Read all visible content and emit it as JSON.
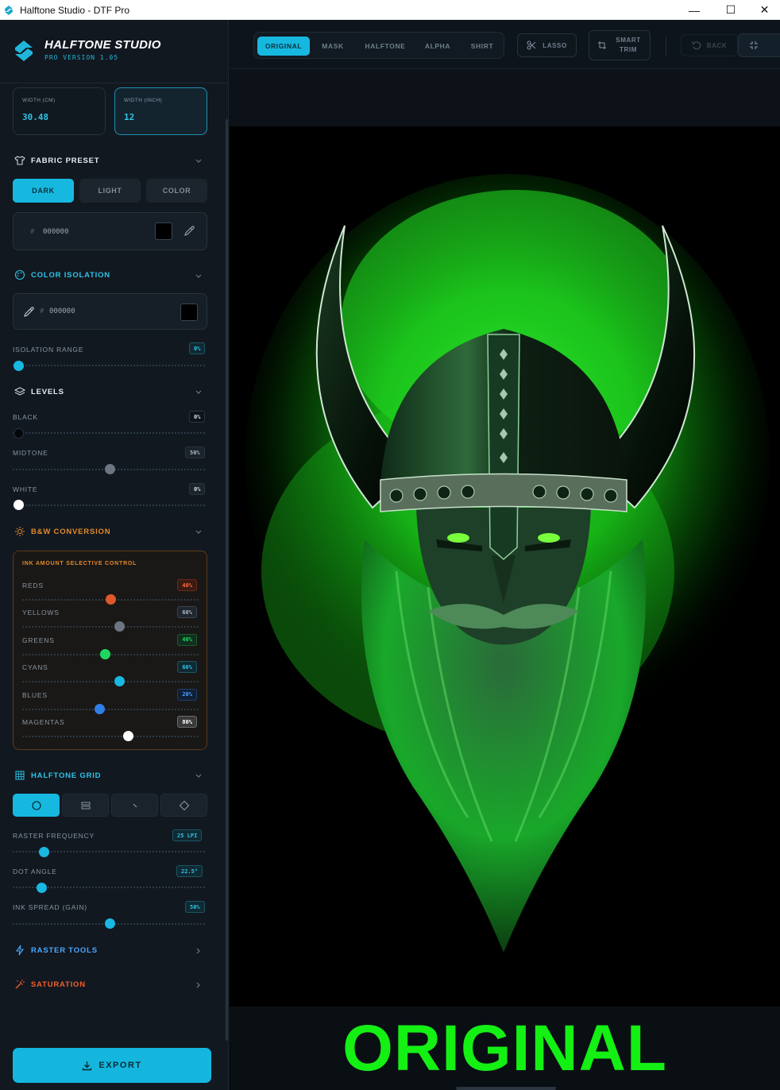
{
  "window": {
    "title": "Halftone Studio - DTF Pro",
    "minimize": "—",
    "maximize": "☐",
    "close": "✕"
  },
  "brand": {
    "name": "HALFTONE STUDIO",
    "version": "PRO VERSION 1.05"
  },
  "dimensions": [
    {
      "label": "WIDTH (CM)",
      "value": "30.48"
    },
    {
      "label": "WIDTH (INCH)",
      "value": "12"
    }
  ],
  "fabric_preset": {
    "title": "FABRIC PRESET",
    "options": [
      "DARK",
      "LIGHT",
      "COLOR"
    ],
    "selected": "DARK",
    "hash": "#",
    "hex": "000000",
    "swatch_color": "#000000"
  },
  "color_isolation": {
    "title": "COLOR ISOLATION",
    "hash": "#",
    "hex": "000000",
    "swatch_color": "#000000",
    "range_label": "ISOLATION RANGE",
    "range_value": "0%",
    "range_level": 0.03
  },
  "levels": {
    "title": "LEVELS",
    "items": [
      {
        "label": "BLACK",
        "value": "0%",
        "level": 0.03
      },
      {
        "label": "MIDTONE",
        "value": "50%",
        "level": 0.5
      },
      {
        "label": "WHITE",
        "value": "0%",
        "level": 0.03
      }
    ]
  },
  "bw_conversion": {
    "title": "B&W CONVERSION",
    "panel_title": "INK AMOUNT SELECTIVE CONTROL",
    "channels": [
      {
        "label": "REDS",
        "value": "40%",
        "level": 0.5,
        "color": "#e0582a"
      },
      {
        "label": "YELLOWS",
        "value": "60%",
        "level": 0.55,
        "color": "#6b7682"
      },
      {
        "label": "GREENS",
        "value": "40%",
        "level": 0.47,
        "color": "#1ed760"
      },
      {
        "label": "CYANS",
        "value": "60%",
        "level": 0.55,
        "color": "#18b8e0"
      },
      {
        "label": "BLUES",
        "value": "20%",
        "level": 0.44,
        "color": "#2f7fe8"
      },
      {
        "label": "MAGENTAS",
        "value": "80%",
        "level": 0.6,
        "color": "#ffffff"
      }
    ]
  },
  "halftone_grid": {
    "title": "HALFTONE GRID",
    "shapes": [
      "circle-icon",
      "lines-icon",
      "diagonal-icon",
      "diamond-icon"
    ],
    "selected": "circle-icon",
    "raster_label": "RASTER FREQUENCY",
    "raster_value": "25 LPI",
    "raster_level": 0.16,
    "angle_label": "DOT ANGLE",
    "angle_value": "22.5°",
    "angle_level": 0.15,
    "spread_label": "INK SPREAD (GAIN)",
    "spread_value": "50%",
    "spread_level": 0.5
  },
  "raster_tools": {
    "title": "RASTER TOOLS"
  },
  "saturation": {
    "title": "SATURATION"
  },
  "export": {
    "label": "EXPORT"
  },
  "view_tabs": {
    "items": [
      "ORIGINAL",
      "MASK",
      "HALFTONE",
      "ALPHA",
      "SHIRT"
    ],
    "selected": "ORIGINAL"
  },
  "tools": {
    "lasso": "LASSO",
    "smart_trim_1": "SMART",
    "smart_trim_2": "TRIM",
    "back": "BACK"
  },
  "canvas": {
    "caption": "ORIGINAL",
    "accent": "#14f014"
  },
  "colors": {
    "accent": "#17b8e0",
    "orange": "#e38a2a",
    "bg": "#121820"
  }
}
